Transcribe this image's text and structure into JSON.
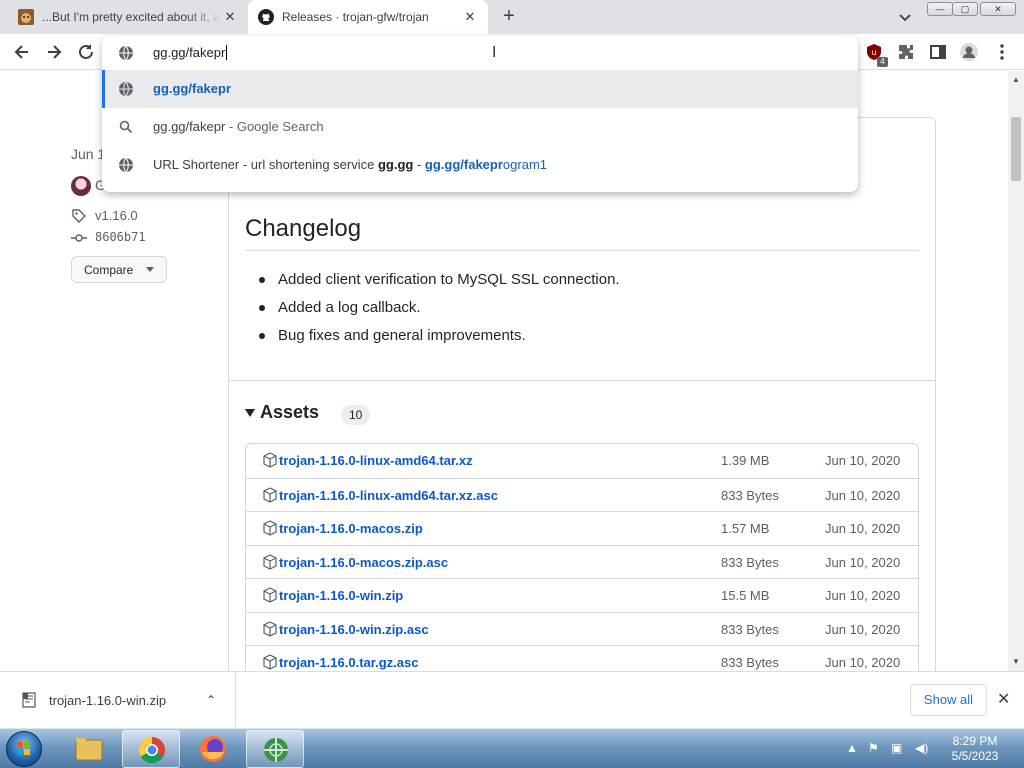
{
  "browser": {
    "tabs": [
      {
        "title": "...But I'm pretty excited about it, a",
        "active": false
      },
      {
        "title": "Releases · trojan-gfw/trojan",
        "active": true
      }
    ],
    "new_tab": "+",
    "window_buttons": {
      "minimize": "—",
      "maximize": "▢",
      "close": "✕"
    }
  },
  "omnibox": {
    "input_value": "gg.gg/fakepr",
    "suggestions": [
      {
        "icon": "globe-icon",
        "link": "gg.gg/fakepr"
      },
      {
        "icon": "search-icon",
        "query": "gg.gg/fakepr",
        "suffix": " - Google Search"
      },
      {
        "icon": "globe-icon",
        "prefix": "URL Shortener - url shortening service ",
        "bold": "gg.gg",
        "sep": " - ",
        "url_bold": "gg.gg/fakepr",
        "url_rest": "ogram1"
      }
    ]
  },
  "extensions": {
    "badge_count": "4"
  },
  "sidebar": {
    "date": "Jun 1",
    "author": "G",
    "tag": "v1.16.0",
    "commit": "8606b71",
    "compare_label": "Compare"
  },
  "release": {
    "changelog_title": "Changelog",
    "changes": [
      "Added client verification to MySQL SSL connection.",
      "Added a log callback.",
      "Bug fixes and general improvements."
    ],
    "assets_title": "Assets",
    "assets_count": "10",
    "assets": [
      {
        "name": "trojan-1.16.0-linux-amd64.tar.xz",
        "size": "1.39 MB",
        "date": "Jun 10, 2020"
      },
      {
        "name": "trojan-1.16.0-linux-amd64.tar.xz.asc",
        "size": "833 Bytes",
        "date": "Jun 10, 2020"
      },
      {
        "name": "trojan-1.16.0-macos.zip",
        "size": "1.57 MB",
        "date": "Jun 10, 2020"
      },
      {
        "name": "trojan-1.16.0-macos.zip.asc",
        "size": "833 Bytes",
        "date": "Jun 10, 2020"
      },
      {
        "name": "trojan-1.16.0-win.zip",
        "size": "15.5 MB",
        "date": "Jun 10, 2020"
      },
      {
        "name": "trojan-1.16.0-win.zip.asc",
        "size": "833 Bytes",
        "date": "Jun 10, 2020"
      },
      {
        "name": "trojan-1.16.0.tar.gz.asc",
        "size": "833 Bytes",
        "date": "Jun 10, 2020"
      }
    ]
  },
  "downloads": {
    "file_name": "trojan-1.16.0-win.zip",
    "show_all_label": "Show all"
  },
  "taskbar": {
    "time": "8:29 PM",
    "date": "5/5/2023"
  },
  "colors": {
    "accent": "#1a73e8",
    "link": "#0a58ca"
  }
}
